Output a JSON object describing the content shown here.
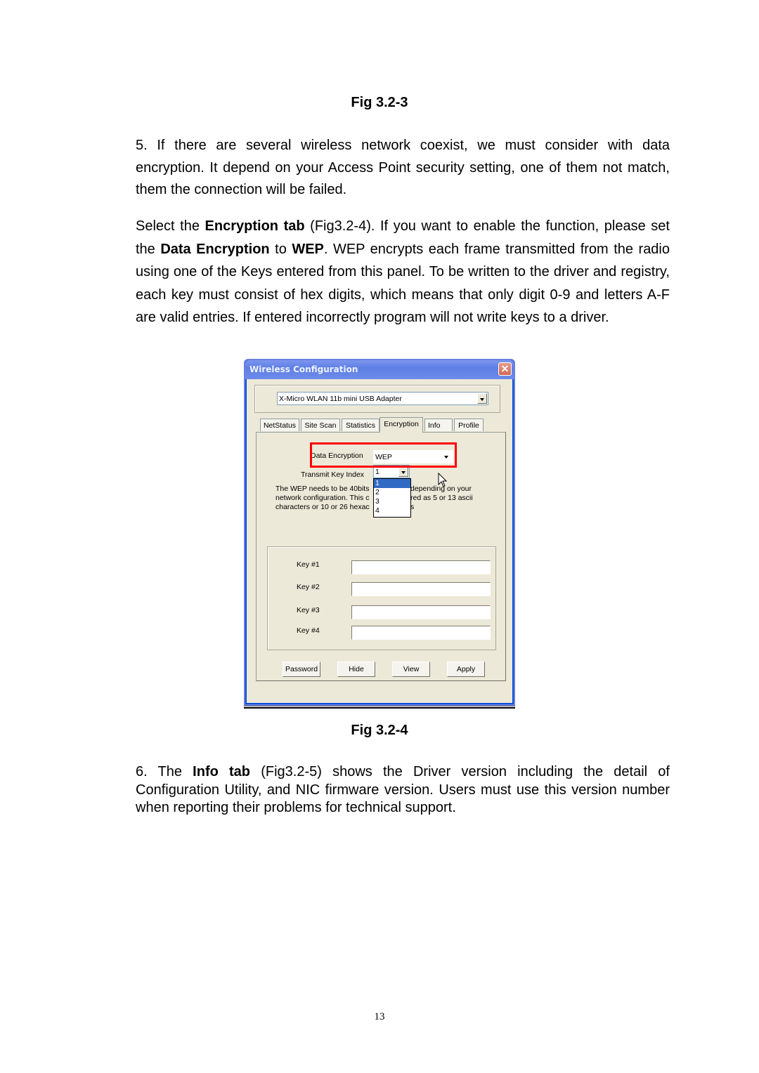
{
  "page": {
    "fig_caption_top": "Fig 3.2-3",
    "para1": "5. If there are several wireless network coexist, we must consider with data encryption. It depend on your Access Point security setting, one of them not match, them the connection will be failed.",
    "para2": {
      "t1": "Select the ",
      "b1": "Encryption tab",
      "t2": " (Fig3.2-4). If you want to enable the function, please set the ",
      "b2": "Data Encryption",
      "t3": " to ",
      "b3": "WEP",
      "t4": ". WEP encrypts each frame transmitted from the radio using one of the Keys entered from this panel. To be written to the driver and registry, each key must consist of hex digits, which means that only digit 0-9 and letters A-F are valid entries. If entered incorrectly program will not write keys to a driver."
    },
    "fig_caption_bottom": "Fig 3.2-4",
    "para3": {
      "t1": "6. The ",
      "b1": "Info tab",
      "t2": " (Fig3.2-5) shows the Driver version including the detail of Configuration Utility, and NIC firmware version. Users must use this version number when reporting their problems for technical support."
    },
    "page_number": "13"
  },
  "dialog": {
    "title": "Wireless Configuration",
    "close_glyph": "✕",
    "adapter": "X-Micro WLAN 11b mini USB Adapter",
    "tabs": [
      {
        "label": "NetStatus"
      },
      {
        "label": "Site Scan"
      },
      {
        "label": "Statistics"
      },
      {
        "label": "Encryption",
        "active": true
      },
      {
        "label": "Info"
      },
      {
        "label": "Profile"
      }
    ],
    "data_encryption_label": "Data Encryption",
    "data_encryption_value": "WEP",
    "transmit_key_label": "Transmit Key Index",
    "transmit_key_value": "1",
    "transmit_key_options": [
      "1",
      "2",
      "3",
      "4"
    ],
    "description": {
      "line1a": "The WEP needs to be 40bits",
      "line1b": "depending on your",
      "line2a": "network configuration. This c",
      "line2b": "red as 5 or 13 ascii",
      "line3a": "characters or 10 or 26 hexac",
      "line3b": "s"
    },
    "keys": [
      {
        "label": "Key #1",
        "value": ""
      },
      {
        "label": "Key #2",
        "value": ""
      },
      {
        "label": "Key #3",
        "value": ""
      },
      {
        "label": "Key #4",
        "value": ""
      }
    ],
    "buttons": {
      "password": "Password",
      "hide": "Hide",
      "view": "View",
      "apply": "Apply"
    },
    "highlight_color": "#ff0000"
  }
}
